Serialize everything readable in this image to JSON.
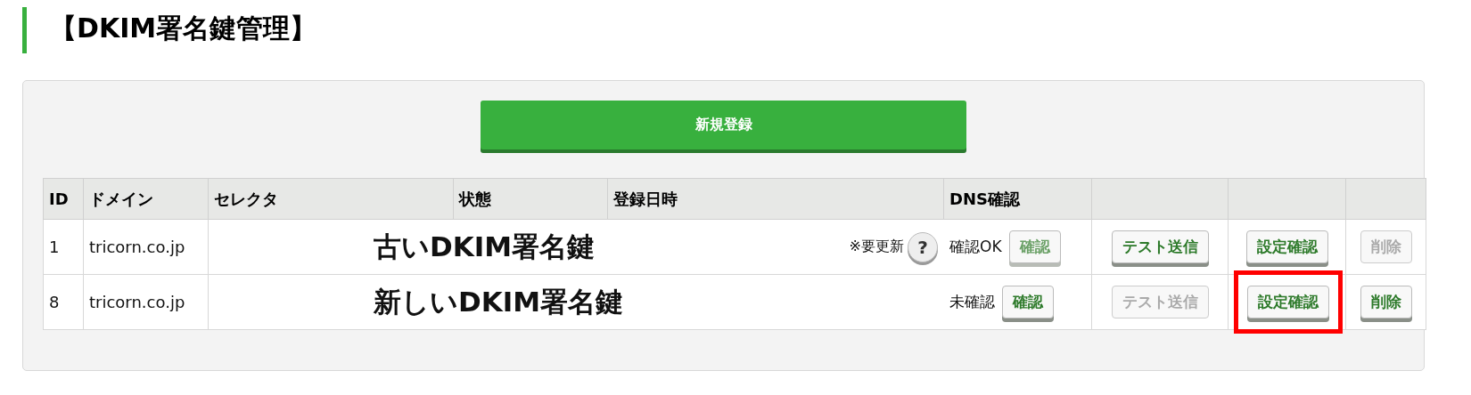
{
  "title": "【DKIM署名鍵管理】",
  "new_button": {
    "label": "新規登録"
  },
  "table": {
    "columns": [
      "ID",
      "ドメイン",
      "セレクタ",
      "状態",
      "登録日時",
      "DNS確認",
      "",
      "",
      ""
    ],
    "rows": [
      {
        "id": "1",
        "domain": "tricorn.co.jp",
        "annotation": "古いDKIM署名鍵",
        "note": "※要更新",
        "help": "?",
        "dns_status": "確認OK",
        "buttons": [
          {
            "label": "確認",
            "kind": "faded",
            "highlighted": false
          },
          {
            "label": "テスト送信",
            "kind": "normal",
            "highlighted": false
          },
          {
            "label": "設定確認",
            "kind": "normal",
            "highlighted": false
          },
          {
            "label": "削除",
            "kind": "disabled",
            "highlighted": false
          }
        ]
      },
      {
        "id": "8",
        "domain": "tricorn.co.jp",
        "annotation": "新しいDKIM署名鍵",
        "dns_status": "未確認",
        "buttons": [
          {
            "label": "確認",
            "kind": "normal",
            "highlighted": false
          },
          {
            "label": "テスト送信",
            "kind": "disabled",
            "highlighted": false
          },
          {
            "label": "設定確認",
            "kind": "normal",
            "highlighted": true
          },
          {
            "label": "削除",
            "kind": "normal",
            "highlighted": false
          }
        ]
      }
    ]
  }
}
